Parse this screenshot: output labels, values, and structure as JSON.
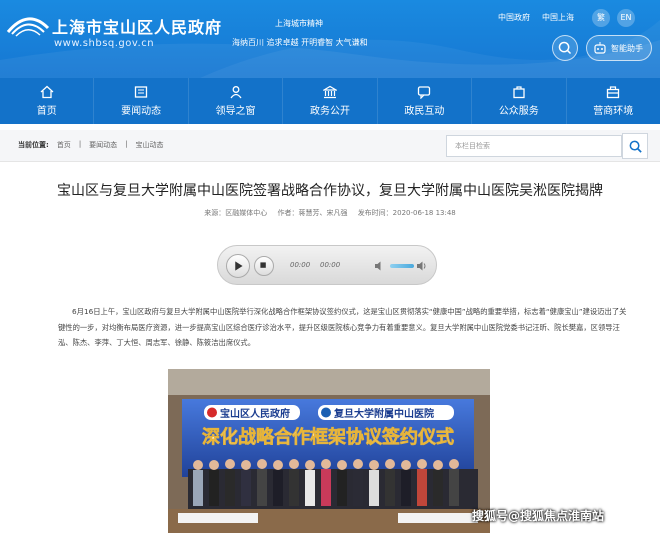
{
  "header": {
    "site_title": "上海市宝山区人民政府",
    "site_url": "www.shbsq.gov.cn",
    "spirit_title": "上海城市精神",
    "spirit_text": "海纳百川 追求卓越 开明睿智 大气谦和",
    "top_links": [
      "中国政府",
      "中国上海"
    ],
    "lang": [
      "繁",
      "EN"
    ],
    "assist_label": "智能助手",
    "colors": {
      "header_bg": "#1a8ae0",
      "nav_bg": "#1372c9"
    }
  },
  "nav": {
    "items": [
      {
        "label": "首页",
        "icon": "home-icon"
      },
      {
        "label": "要闻动态",
        "icon": "news-icon"
      },
      {
        "label": "领导之窗",
        "icon": "leader-icon"
      },
      {
        "label": "政务公开",
        "icon": "government-icon"
      },
      {
        "label": "政民互动",
        "icon": "interaction-icon"
      },
      {
        "label": "公众服务",
        "icon": "service-icon"
      },
      {
        "label": "营商环境",
        "icon": "business-icon"
      }
    ]
  },
  "breadcrumb": {
    "label": "当前位置:",
    "items": [
      "首页",
      "要闻动态",
      "宝山动态"
    ]
  },
  "search": {
    "placeholder": "本栏目检索"
  },
  "article": {
    "title": "宝山区与复旦大学附属中山医院签署战略合作协议，复旦大学附属中山医院吴淞医院揭牌",
    "source": "来源：区融媒体中心",
    "author": "作者：蒋慧芳、宋凡强",
    "date": "发布时间：2020-06-18 13:48",
    "audio": {
      "current": "00:00",
      "total": "00:00"
    },
    "paragraph": "6月16日上午，宝山区政府与复旦大学附属中山医院举行深化战略合作框架协议签约仪式，这是宝山区贯彻落实“健康中国”战略的重要举措，标志着“健康宝山”建设迈出了关键性的一步，对均衡布局医疗资源，进一步提高宝山区综合医疗诊治水平，提升区级医院核心竞争力有着重要意义。复旦大学附属中山医院党委书记汪昕、院长樊嘉，区领导汪泓、陈杰、李萍、丁大恒、周志军、徐静、陈筱洁出席仪式。"
  },
  "photo": {
    "banner_left": "宝山区人民政府",
    "banner_right": "复旦大学附属中山医院",
    "banner_main": "深化战略合作框架协议签约仪式"
  },
  "watermark": "搜狐号@搜狐焦点淮南站"
}
